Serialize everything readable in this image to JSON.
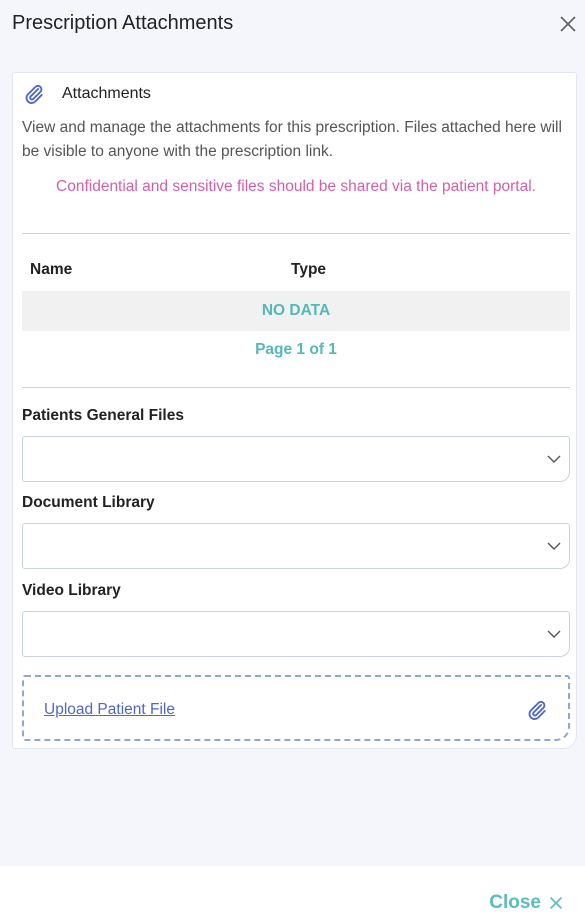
{
  "header": {
    "title": "Prescription Attachments",
    "close_icon": "close-icon"
  },
  "attachments": {
    "heading": "Attachments",
    "icon": "paperclip-icon",
    "description": "View and manage the attachments for this prescription. Files attached here will be visible to anyone with the prescription link.",
    "warning": "Confidential and sensitive files should be shared via the patient portal."
  },
  "table": {
    "columns": [
      "Name",
      "Type"
    ],
    "empty_text": "NO DATA",
    "pagination": "Page 1 of 1"
  },
  "fields": [
    {
      "label": "Patients General Files",
      "value": ""
    },
    {
      "label": "Document Library",
      "value": ""
    },
    {
      "label": "Video Library",
      "value": ""
    }
  ],
  "upload": {
    "label": "Upload Patient File",
    "icon": "paperclip-icon"
  },
  "footer": {
    "close_label": "Close"
  },
  "colors": {
    "accent_teal": "#55b8b8",
    "warning_pink": "#d45fa9",
    "link_blue": "#4e67c7",
    "background": "#f4f6fb"
  }
}
